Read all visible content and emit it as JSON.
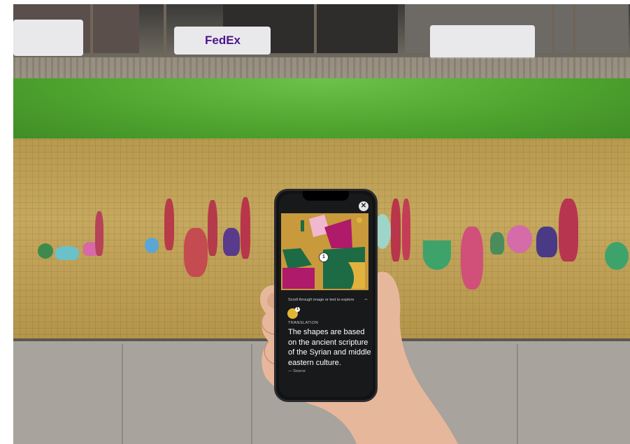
{
  "background": {
    "truck_left_label": "",
    "truck_center_label": "FedEx",
    "truck_right_label": ""
  },
  "phone": {
    "close_icon": "close-icon",
    "artwork": {
      "marker_number": "1"
    },
    "hint_text": "Scroll through image or text to explore",
    "hint_icon": "swipe-icon",
    "badge_icon": "translation-badge-icon",
    "badge_count": "1",
    "section_label": "TRANSLATION",
    "body_text": "The shapes are based on the ancient scripture of the Syrian and middle eastern culture.",
    "source_text": "— Source"
  },
  "colors": {
    "accent_gold": "#e0b636",
    "screen_bg": "#18191b",
    "magenta": "#b01a6a",
    "green": "#1d6b45"
  }
}
